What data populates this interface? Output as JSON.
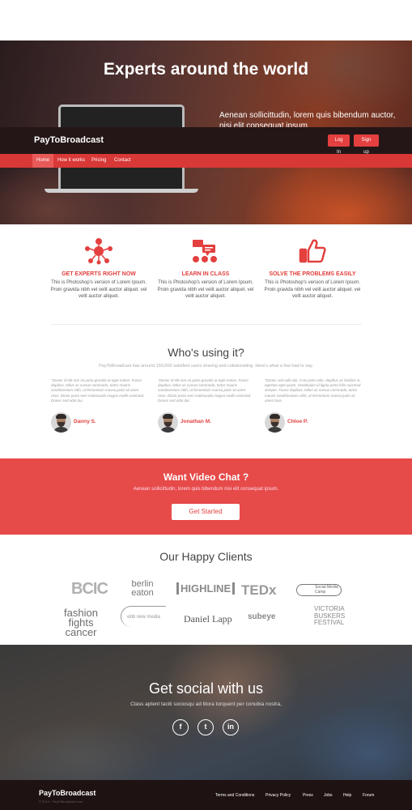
{
  "hero": {
    "title": "Experts around the world",
    "subtitle": "Aenean sollicittudin, lorem quis bibendum auctor, nisi elit consequat ipsum."
  },
  "site": {
    "logo": "PayToBroadcast",
    "login": "Log In",
    "signup": "Sign up",
    "nav": [
      "Home",
      "How it works",
      "Pricing",
      "Contact"
    ]
  },
  "features": [
    {
      "icon": "network-people-icon",
      "title": "GET EXPERTS RIGHT NOW",
      "text": "This is Photoshop's version of Lorem Ipsum. Proin gravida nibh vel velit auctor aliquet. vel velit auctor aliquet."
    },
    {
      "icon": "class-chat-icon",
      "title": "LEARN IN CLASS",
      "text": "This is Photoshop's version of Lorem Ipsum. Proin gravida nibh vel velit auctor aliquet. vel velit auctor aliquet."
    },
    {
      "icon": "thumbs-up-icon",
      "title": "SOLVE THE PROBLEMS EASILY",
      "text": "This is Photoshop's version of Lorem Ipsum. Proin gravida nibh vel velit auctor aliquet. vel velit auctor aliquet."
    }
  ],
  "testimonials": {
    "title": "Who's using it?",
    "subtitle": "PayToBroadcast has around 150,000 satisfied users sharing and collaborating. Here's what a few had to say.",
    "items": [
      {
        "quote": "\"Donec id elit non mi porta gravida at eget metus. Fusce dapibus, tellus ac cursus commodo, tortor mauris condimentum nibh, ut fermentum massa justo sit amet risus. Etiam porta sem malesuada magna mollis euismod. Donec sed odio dui.",
        "name": "Danny S."
      },
      {
        "quote": "\"Donec id elit non mi porta gravida at eget metus. Fusce dapibus, tellus ac cursus commodo, tortor mauris condimentum nibh, ut fermentum massa justo sit amet risus. Etiam porta sem malesuada magna mollis euismod. Donec sed odio dui.",
        "name": "Jonathan M."
      },
      {
        "quote": "\"Donec sed odio dui. Cras justo odio, dapibus ac facilisis in, egestas eget quam. Vestibulum id ligula porta felis euismod semper. Fusce dapibus, tellus ac cursus commodo, tortor mauris condimentum nibh, ut fermentum massa justo sit amet risus.",
        "name": "Chloe P."
      }
    ]
  },
  "cta": {
    "title": "Want Video Chat ?",
    "subtitle": "Aenean sollicittudin, lorem quis bibendum nisi elit consequat ipsum.",
    "button": "Get Started"
  },
  "clients": {
    "title": "Our Happy Clients",
    "logos": [
      "BCIC",
      "berlin eaton",
      "HIGHLINE",
      "TEDx",
      "Social Media Camp",
      "fashion fights cancer",
      "ebb new media",
      "Daniel Lapp",
      "subeye",
      "VICTORIA BUSKERS FESTIVAL"
    ]
  },
  "social": {
    "title": "Get social with us",
    "subtitle": "Class aptent taciti sociosqu ad litora torquent per conubia nostra,",
    "icons": [
      "f",
      "t",
      "in"
    ]
  },
  "footer": {
    "logo": "PayToBroadcast",
    "copyright": "© 2014 - PayToBroadcast.com",
    "links": [
      "Terms and Conditions",
      "Privacy Policy",
      "Press",
      "Jobs",
      "Help",
      "Forum"
    ]
  },
  "colors": {
    "accent": "#e3403f",
    "cta_bg": "#e64a49",
    "footer_bg": "#1e1212"
  }
}
